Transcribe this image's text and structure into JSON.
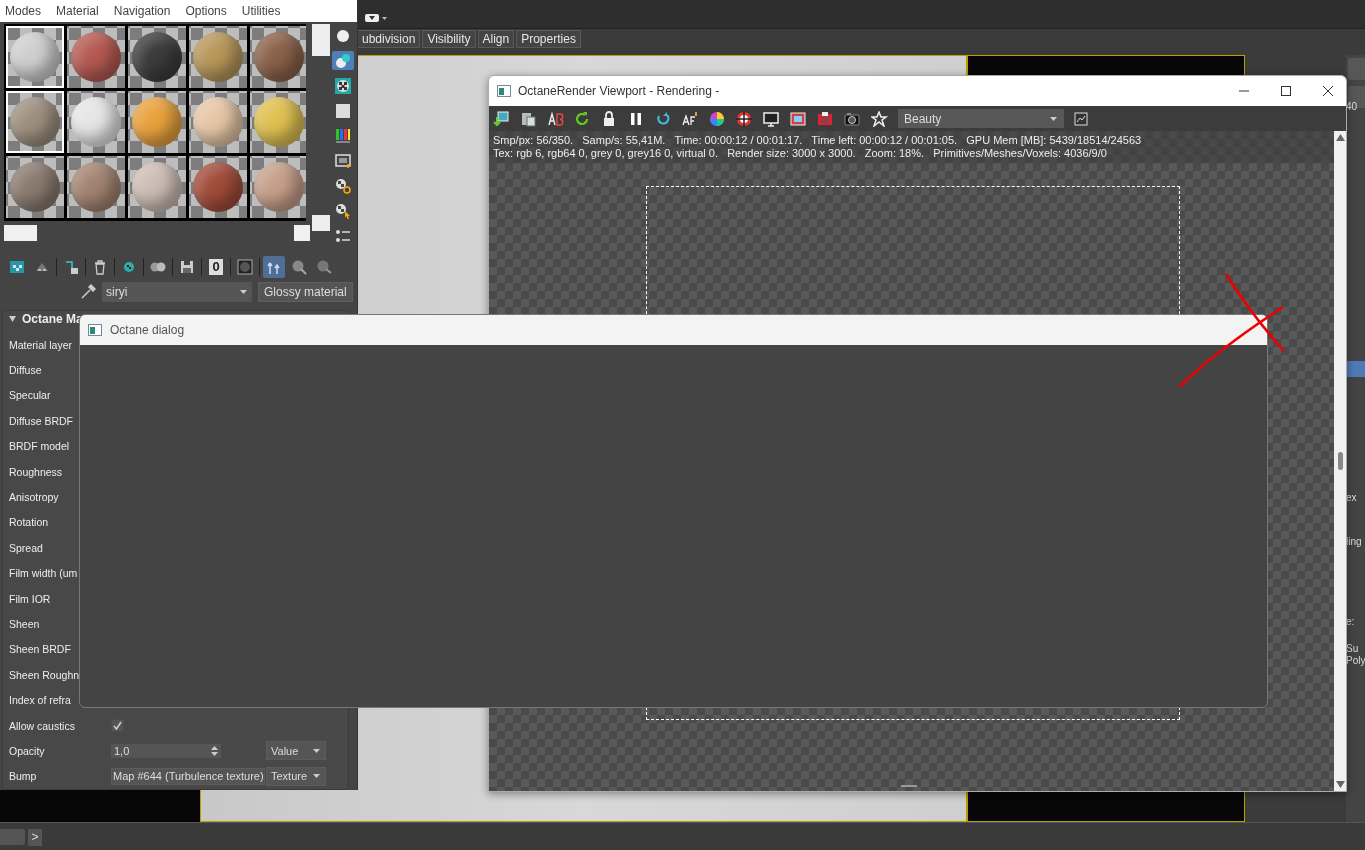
{
  "app": {
    "ribbon_tabs": [
      "ubdivision",
      "Visibility",
      "Align",
      "Properties"
    ],
    "command_panel_fragments": [
      "40",
      "ex",
      "ling",
      "e:",
      "Su",
      "Poly"
    ],
    "status_bar": {
      "expand_button": ">"
    }
  },
  "material_editor": {
    "menu": [
      "Modes",
      "Material",
      "Navigation",
      "Options",
      "Utilities"
    ],
    "sample_slots": [
      {
        "color": "#cfcfcf",
        "selected": true
      },
      {
        "color": "#b65a52",
        "selected": false
      },
      {
        "color": "#3c3c3c",
        "selected": false
      },
      {
        "color": "#b8975a",
        "selected": false
      },
      {
        "color": "#8b6149",
        "selected": false
      },
      {
        "color": "#9d8f80",
        "selected": true
      },
      {
        "color": "#e6e6e6",
        "selected": false
      },
      {
        "color": "#e8a23e",
        "selected": false
      },
      {
        "color": "#e6c7a6",
        "selected": false
      },
      {
        "color": "#dfc052",
        "selected": false
      },
      {
        "color": "#8a7b70",
        "selected": false
      },
      {
        "color": "#a38472",
        "selected": false
      },
      {
        "color": "#cdbdb4",
        "selected": false
      },
      {
        "color": "#a24c3a",
        "selected": false
      },
      {
        "color": "#c69f8a",
        "selected": false
      }
    ],
    "side_tools": [
      {
        "selected": false
      },
      {
        "selected": true
      },
      {
        "selected": false
      },
      {
        "selected": false
      },
      {
        "selected": false
      },
      {
        "selected": false
      },
      {
        "selected": false
      },
      {
        "selected": false
      },
      {
        "selected": false
      }
    ],
    "bottom_tools": [
      {
        "kind": "icon",
        "selected": false
      },
      {
        "kind": "icon",
        "selected": false
      },
      {
        "kind": "icon",
        "selected": false
      },
      {
        "kind": "icon",
        "selected": false
      },
      {
        "kind": "icon",
        "selected": false
      },
      {
        "kind": "icon",
        "selected": false
      },
      {
        "kind": "icon",
        "selected": false
      },
      {
        "kind": "text",
        "text": "0",
        "selected": false
      },
      {
        "kind": "icon",
        "selected": false
      },
      {
        "kind": "icon",
        "selected": true
      },
      {
        "kind": "icon",
        "selected": false
      },
      {
        "kind": "icon",
        "selected": false
      }
    ],
    "material_name": "siryi",
    "material_type": "Glossy material",
    "rollout_title": "Octane Ma",
    "parameters": [
      {
        "kind": "label",
        "label": "Material layer"
      },
      {
        "kind": "label",
        "label": "Diffuse"
      },
      {
        "kind": "label",
        "label": "Specular"
      },
      {
        "kind": "label",
        "label": "Diffuse BRDF"
      },
      {
        "kind": "label",
        "label": "BRDF model"
      },
      {
        "kind": "label",
        "label": "Roughness"
      },
      {
        "kind": "label",
        "label": "Anisotropy"
      },
      {
        "kind": "label",
        "label": "Rotation"
      },
      {
        "kind": "label",
        "label": "Spread"
      },
      {
        "kind": "label",
        "label": "Film width (um"
      },
      {
        "kind": "label",
        "label": "Film IOR"
      },
      {
        "kind": "label",
        "label": "Sheen"
      },
      {
        "kind": "label",
        "label": "Sheen BRDF"
      },
      {
        "kind": "label",
        "label": "Sheen Roughn"
      },
      {
        "kind": "label",
        "label": "Index of refra"
      },
      {
        "kind": "checkbox",
        "label": "Allow caustics",
        "checked": true
      },
      {
        "kind": "spinner",
        "label": "Opacity",
        "value": "1,0",
        "mode": "Value"
      },
      {
        "kind": "map",
        "label": "Bump",
        "value": "Map #644 (Turbulence texture)",
        "mode": "Texture"
      }
    ]
  },
  "render_viewport": {
    "title": "OctaneRender Viewport - Rendering -",
    "pass": "Beauty",
    "stats": [
      "Smp/px: 56/350.   Samp/s: 55,41M.   Time: 00:00:12 / 00:01:17.   Time left: 00:00:12 / 00:01:05.   GPU Mem [MB]: 5439/18514/24563",
      "Tex: rgb 6, rgb64 0, grey 0, grey16 0, virtual 0.   Render size: 3000 x 3000.   Zoom: 18%.   Primitives/Meshes/Voxels: 4036/9/0"
    ]
  },
  "dialog": {
    "title": "Octane dialog"
  }
}
